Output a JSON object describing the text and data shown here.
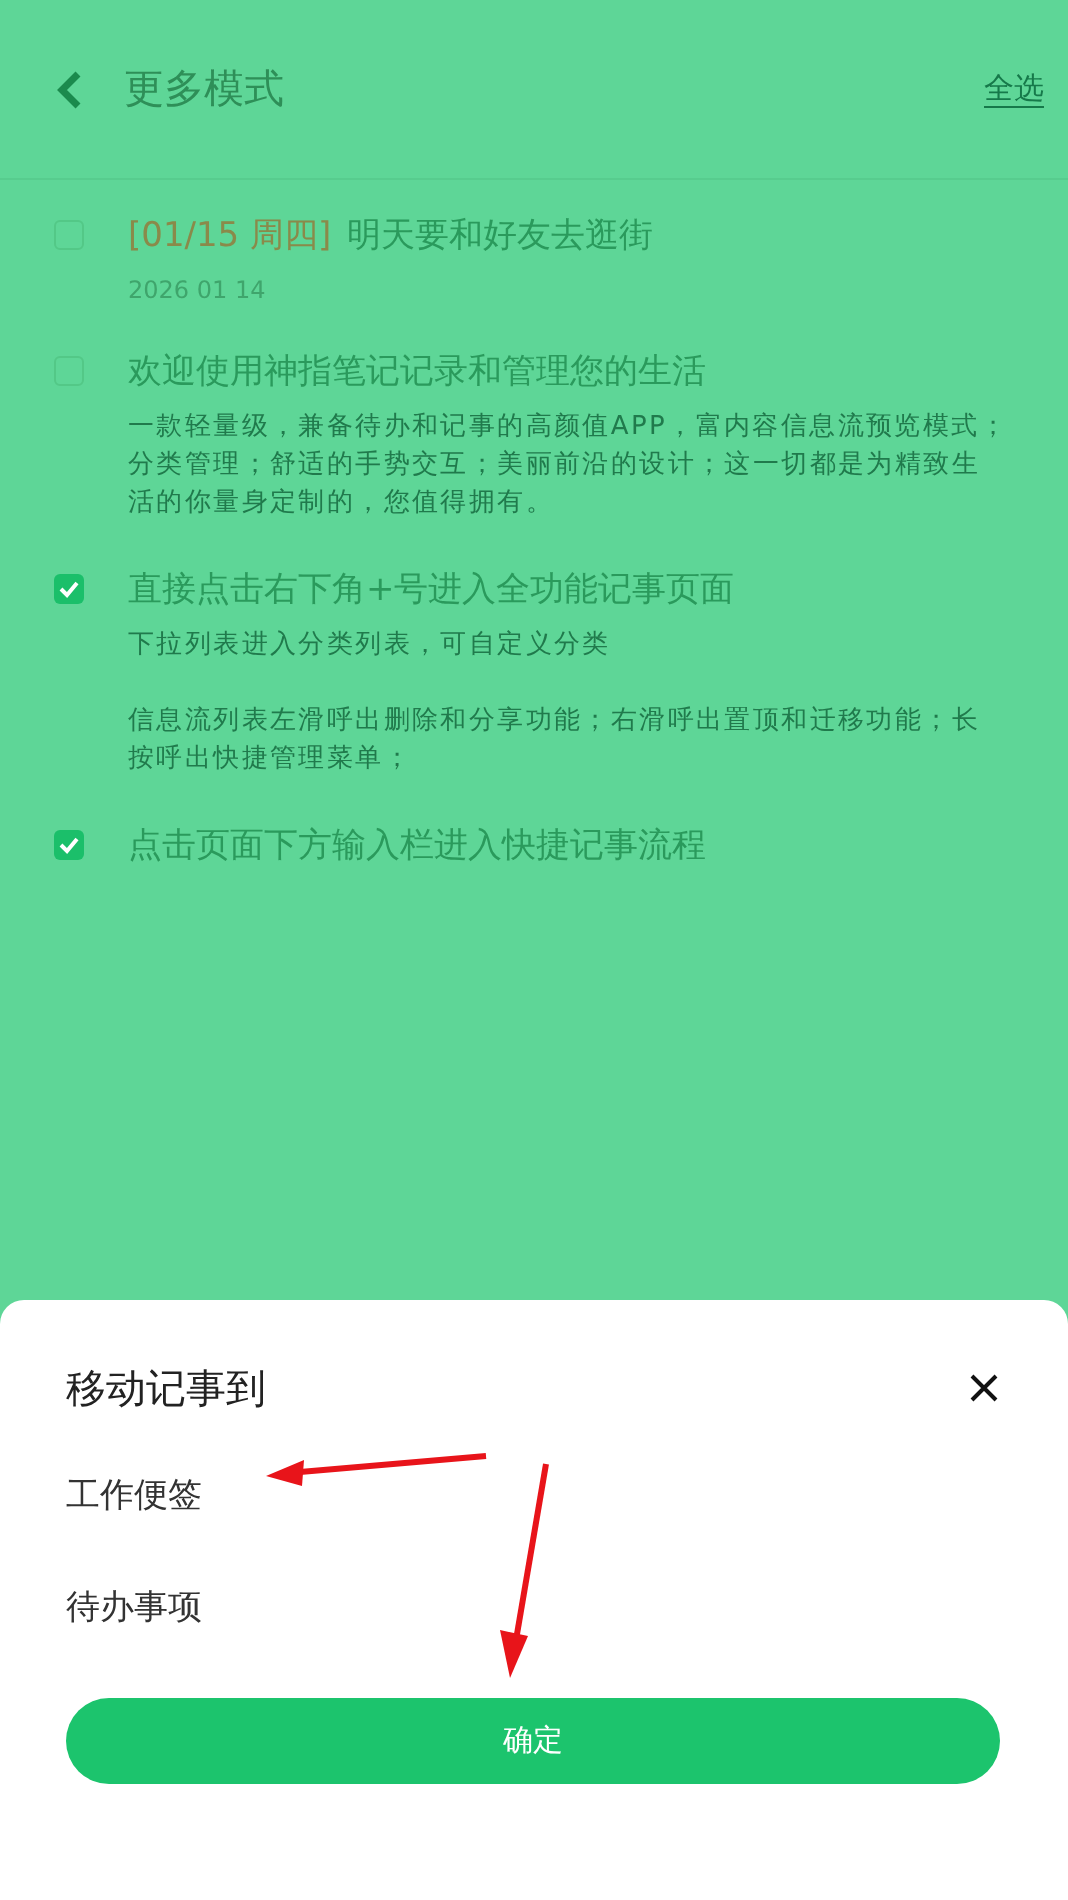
{
  "header": {
    "title": "更多模式",
    "select_all": "全选"
  },
  "notes": [
    {
      "checked": false,
      "tag": "[01/15 周四]",
      "title": "明天要和好友去逛街",
      "date": "2026 01 14"
    },
    {
      "checked": false,
      "title": "欢迎使用神指笔记记录和管理您的生活",
      "body": [
        "一款轻量级，兼备待办和记事的高颜值APP，富内容信息流预览模式；分类管理；舒适的手势交互；美丽前沿的设计；这一切都是为精致生活的你量身定制的，您值得拥有。"
      ]
    },
    {
      "checked": true,
      "title": "直接点击右下角+号进入全功能记事页面",
      "body": [
        "下拉列表进入分类列表，可自定义分类",
        "信息流列表左滑呼出删除和分享功能；右滑呼出置顶和迁移功能；长按呼出快捷管理菜单；"
      ]
    },
    {
      "checked": true,
      "title": "点击页面下方输入栏进入快捷记事流程"
    }
  ],
  "sheet": {
    "title": "移动记事到",
    "options": [
      "工作便签",
      "待办事项"
    ],
    "confirm": "确定"
  }
}
